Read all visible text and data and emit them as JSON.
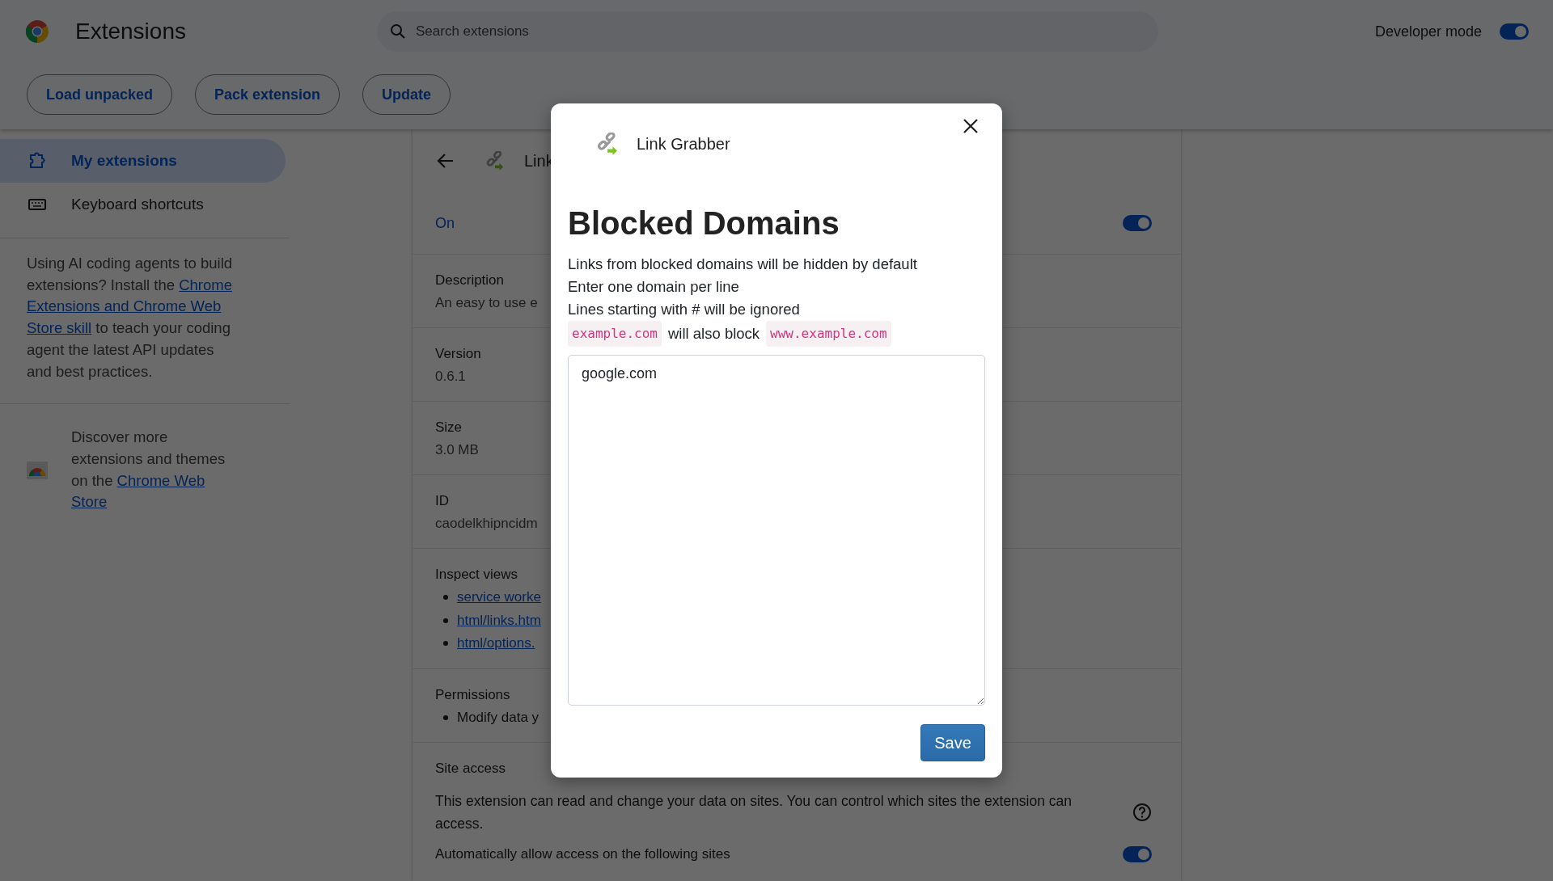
{
  "header": {
    "title": "Extensions",
    "search": {
      "placeholder": "Search extensions"
    },
    "developer_mode": {
      "label": "Developer mode",
      "on": true
    }
  },
  "toolbar": {
    "buttons": [
      "Load unpacked",
      "Pack extension",
      "Update"
    ]
  },
  "sidebar": {
    "items": [
      {
        "label": "My extensions",
        "selected": true,
        "kind": "puzzle"
      },
      {
        "label": "Keyboard shortcuts",
        "selected": false,
        "kind": "keyboard"
      }
    ],
    "promo": {
      "lines": [
        [
          {
            "kind": "text",
            "text": "Using AI coding agents to build"
          }
        ],
        [
          {
            "kind": "text",
            "text": "extensions? Install the "
          },
          {
            "kind": "link",
            "text": "Chrome"
          }
        ],
        [
          {
            "kind": "link",
            "text": "Extensions and Chrome Web"
          }
        ],
        [
          {
            "kind": "link",
            "text": "Store skill"
          },
          {
            "kind": "text",
            "text": " to teach your coding"
          }
        ],
        [
          {
            "kind": "text",
            "text": "agent the latest API updates"
          }
        ],
        [
          {
            "kind": "text",
            "text": "and best practices."
          }
        ]
      ]
    },
    "store": {
      "lines": [
        [
          {
            "kind": "text",
            "text": "Discover more"
          }
        ],
        [
          {
            "kind": "text",
            "text": "extensions and themes"
          }
        ],
        [
          {
            "kind": "text",
            "text": "on the "
          },
          {
            "kind": "link",
            "text": "Chrome Web"
          }
        ],
        [
          {
            "kind": "link",
            "text": "Store"
          }
        ]
      ]
    }
  },
  "details": {
    "title": "Link",
    "status": "On",
    "on": true,
    "sections": [
      {
        "kind": "field",
        "label": "Description",
        "value": "An easy to use e"
      },
      {
        "kind": "field",
        "label": "Version",
        "value": "0.6.1"
      },
      {
        "kind": "field",
        "label": "Size",
        "value": "3.0 MB"
      },
      {
        "kind": "field",
        "label": "ID",
        "value": "caodelkhipncidm"
      },
      {
        "kind": "links",
        "label": "Inspect views",
        "items": [
          "service worke",
          "html/links.htm",
          "html/options."
        ]
      },
      {
        "kind": "list",
        "label": "Permissions",
        "items": [
          "Modify data y"
        ]
      }
    ],
    "site_access": {
      "label": "Site access",
      "text": "This extension can read and change your data on sites. You can control which sites the extension can access.",
      "auto_allow": {
        "label": "Automatically allow access on the following sites",
        "on": true
      }
    }
  },
  "dialog": {
    "extension_name": "Link Grabber",
    "heading": "Blocked Domains",
    "notes": [
      "Links from blocked domains will be hidden by default",
      "Enter one domain per line",
      "Lines starting with # will be ignored"
    ],
    "example": {
      "domain": "example.com",
      "middle": "will also block",
      "subdomain": "www.example.com"
    },
    "textarea": {
      "value": "google.com"
    },
    "save": "Save"
  }
}
